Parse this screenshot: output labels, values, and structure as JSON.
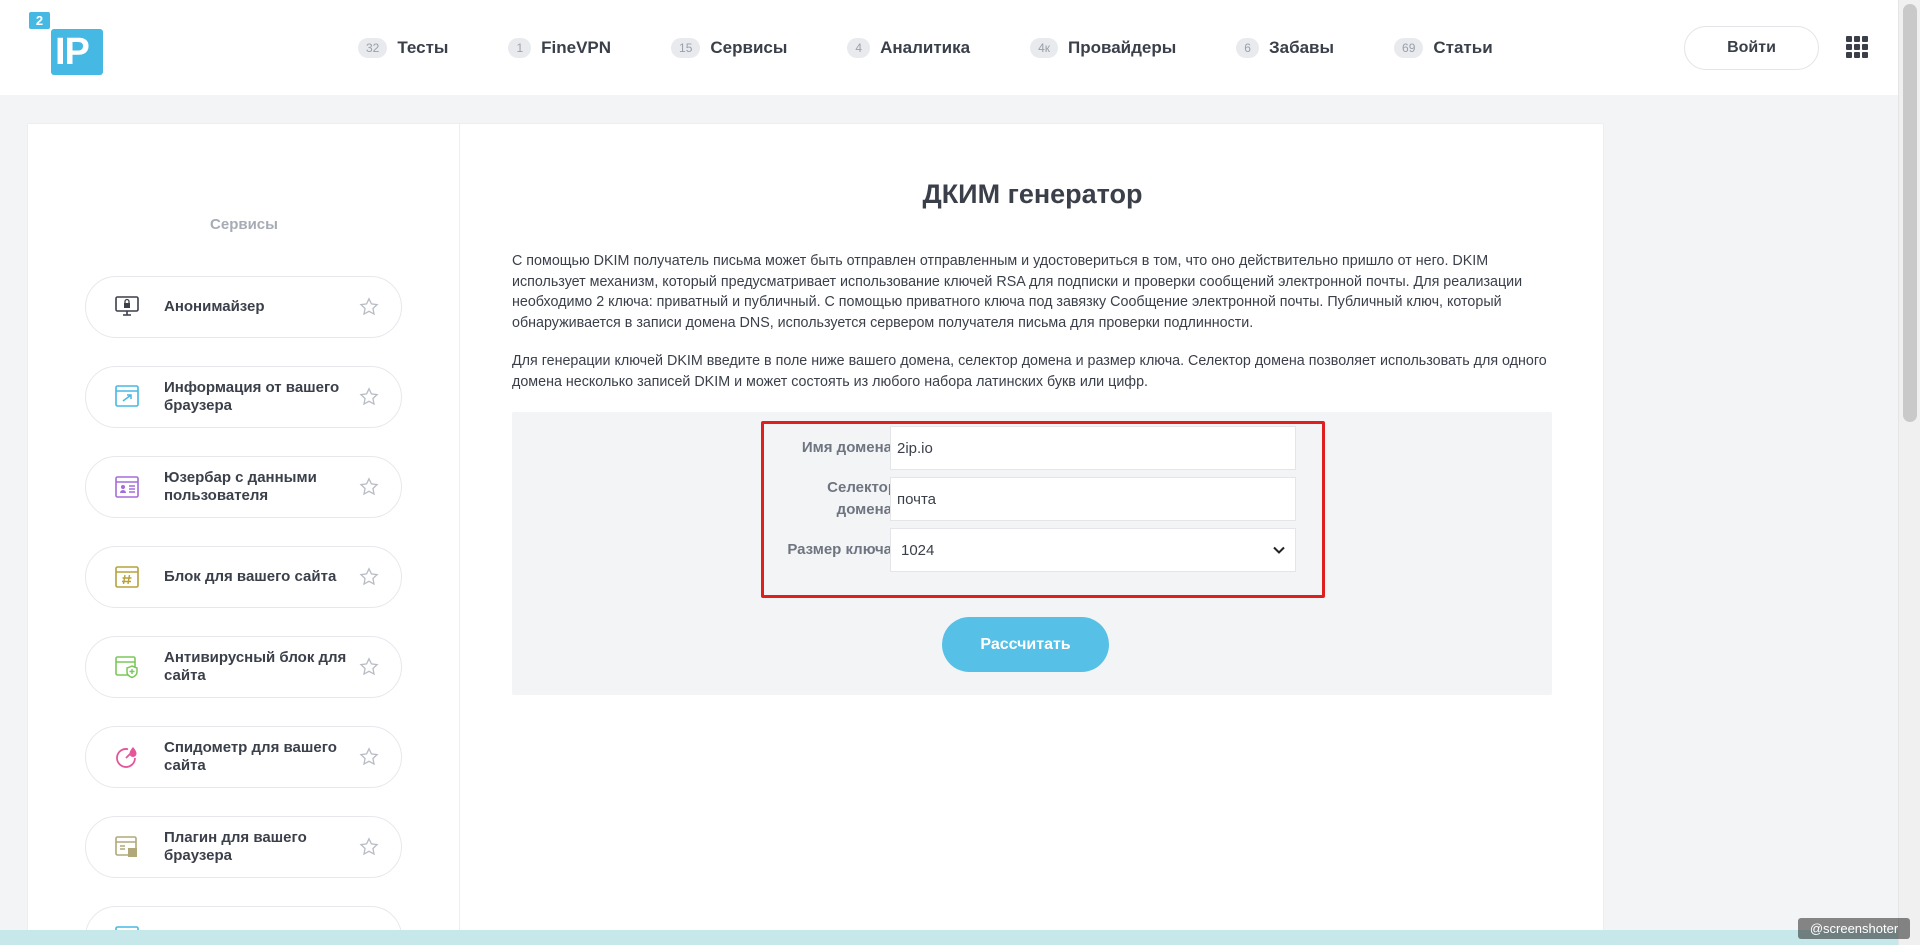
{
  "header": {
    "logo": {
      "sup": "2",
      "main": "IP"
    },
    "nav": [
      {
        "badge": "32",
        "label": "Тесты"
      },
      {
        "badge": "1",
        "label": "FineVPN"
      },
      {
        "badge": "15",
        "label": "Сервисы"
      },
      {
        "badge": "4",
        "label": "Аналитика"
      },
      {
        "badge": "4к",
        "label": "Провайдеры"
      },
      {
        "badge": "6",
        "label": "Забавы"
      },
      {
        "badge": "69",
        "label": "Статьи"
      }
    ],
    "login_label": "Войти"
  },
  "sidebar": {
    "title": "Сервисы",
    "items": [
      {
        "label": "Анонимайзер",
        "icon": "monitor-lock-icon"
      },
      {
        "label": "Информация от вашего браузера",
        "icon": "browser-window-icon"
      },
      {
        "label": "Юзербар с данными пользователя",
        "icon": "user-card-icon"
      },
      {
        "label": "Блок для вашего сайта",
        "icon": "hash-window-icon"
      },
      {
        "label": "Антивирусный блок для сайта",
        "icon": "shield-window-icon"
      },
      {
        "label": "Спидометр для вашего сайта",
        "icon": "speedometer-icon"
      },
      {
        "label": "Плагин для вашего браузера",
        "icon": "plugin-window-icon"
      }
    ]
  },
  "main": {
    "title": "ДКИМ генератор",
    "desc1": "С помощью DKIM получатель письма может быть отправлен отправленным и удостовериться в том, что оно действительно пришло от него. DKIM использует механизм, который предусматривает использование ключей RSA для подписки и проверки сообщений электронной почты. Для реализации необходимо 2 ключа: приватный и публичный. С помощью приватного ключа под завязку Сообщение электронной почты. Публичный ключ, который обнаруживается в записи домена DNS, используется сервером получателя письма для проверки подлинности.",
    "desc2": "Для генерации ключей DKIM введите в поле ниже вашего домена, селектор домена и размер ключа. Селектор домена позволяет использовать для одного домена несколько записей DKIM и может состоять из любого набора латинских букв или цифр.",
    "form": {
      "domain_label": "Имя домена:",
      "domain_value": "2ip.io",
      "selector_label_1": "Селектор",
      "selector_label_2": "домена:",
      "selector_value": "почта",
      "keysize_label": "Размер ключа:",
      "keysize_value": "1024"
    },
    "calc_label": "Рассчитать"
  },
  "watermark": "@screenshoter",
  "colors": {
    "accent": "#45b8e3",
    "button": "#56c0e6",
    "highlight": "#e01e1e"
  }
}
